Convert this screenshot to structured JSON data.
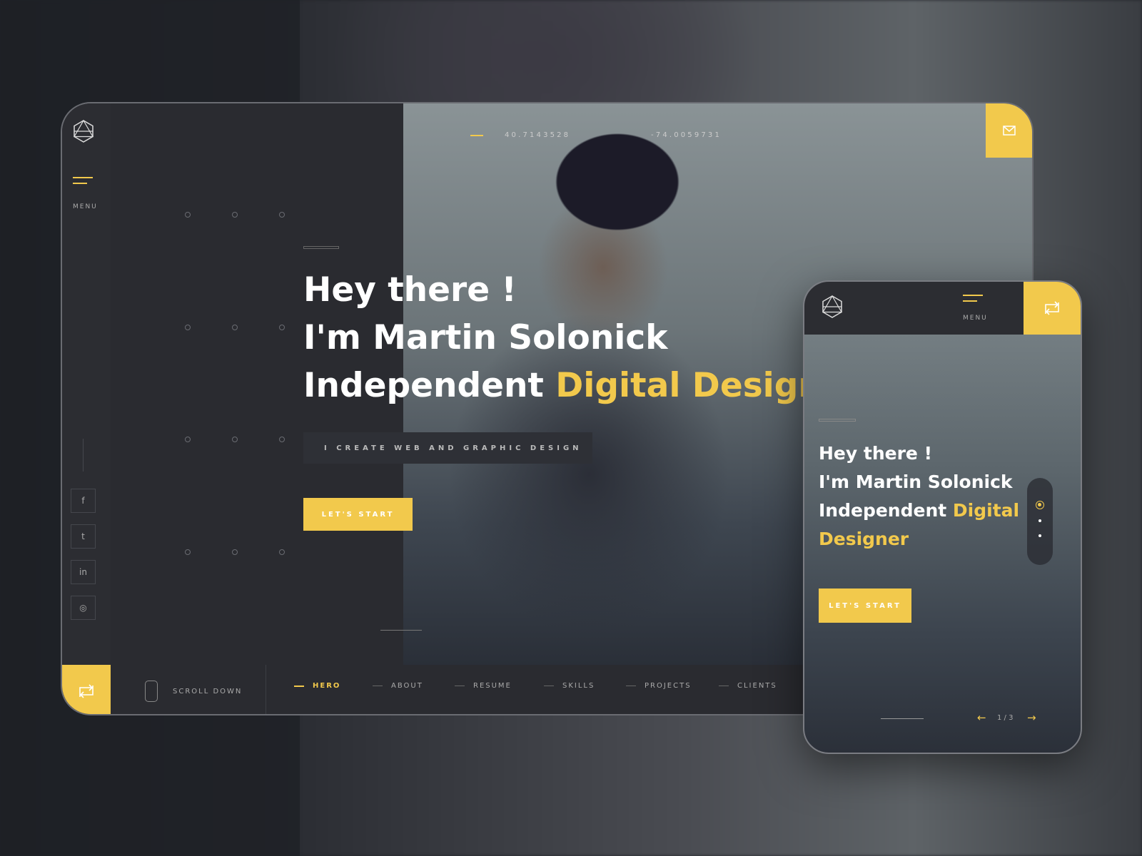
{
  "colors": {
    "accent": "#f2c94c",
    "dark": "#2a2b30"
  },
  "desktop": {
    "menu_label": "MENU",
    "coords": {
      "lat": "4 0 . 7 1 4 3 5 2 8",
      "lng": "- 7 4 . 0 0 5 9 7 3 1"
    },
    "headline": {
      "line1": "Hey there !",
      "line2": "I'm Martin Solonick",
      "line3_a": "Independent ",
      "line3_b": "Digital Designer"
    },
    "tagline": "I CREATE WEB AND GRAPHIC DESIGN",
    "cta": "LET'S START",
    "social": [
      {
        "icon": "facebook-icon",
        "glyph": "f"
      },
      {
        "icon": "twitter-icon",
        "glyph": "t"
      },
      {
        "icon": "linkedin-icon",
        "glyph": "in"
      },
      {
        "icon": "instagram-icon",
        "glyph": "◎"
      }
    ],
    "scroll_label": "SCROLL DOWN",
    "nav": [
      {
        "label": "HERO",
        "active": true
      },
      {
        "label": "ABOUT"
      },
      {
        "label": "RESUME"
      },
      {
        "label": "SKILLS"
      },
      {
        "label": "PROJECTS"
      },
      {
        "label": "CLIENTS"
      }
    ]
  },
  "mobile": {
    "menu_label": "MENU",
    "headline": {
      "line1": "Hey there !",
      "line2": "I'm Martin Solonick",
      "line3_a": "Independent ",
      "line3_b": "Digital",
      "line4": "Designer"
    },
    "cta": "LET'S START",
    "pager": "1 / 3"
  }
}
